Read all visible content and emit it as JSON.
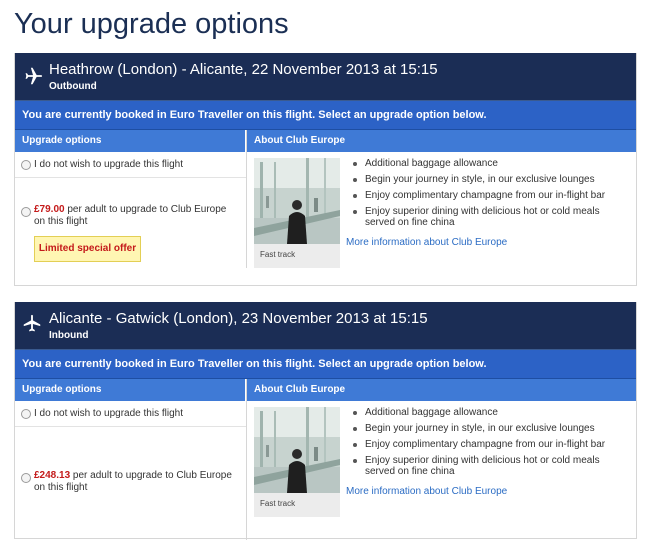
{
  "page": {
    "title": "Your upgrade options"
  },
  "flights": [
    {
      "title": "Heathrow (London) - Alicante, 22 November 2013 at 15:15",
      "direction": "Outbound",
      "notice": "You are currently booked in Euro Traveller on this flight. Select an upgrade option below.",
      "options_header": "Upgrade options",
      "about_header": "About Club Europe",
      "no_upgrade_label": "I do not wish to upgrade this flight",
      "upgrade_price": "£79.00",
      "upgrade_text": " per adult to upgrade to Club Europe on this flight",
      "offer_label": "Limited special offer",
      "photo_caption": "Fast track",
      "benefits": [
        "Additional baggage allowance",
        "Begin your journey in style, in our exclusive lounges",
        "Enjoy complimentary champagne from our in-flight bar",
        "Enjoy superior dining with delicious hot or cold meals served on fine china"
      ],
      "more_link": "More information about Club Europe"
    },
    {
      "title": "Alicante - Gatwick (London), 23 November 2013 at 15:15",
      "direction": "Inbound",
      "notice": "You are currently booked in Euro Traveller on this flight. Select an upgrade option below.",
      "options_header": "Upgrade options",
      "about_header": "About Club Europe",
      "no_upgrade_label": "I do not wish to upgrade this flight",
      "upgrade_price": "£248.13",
      "upgrade_text": " per adult to upgrade to Club Europe on this flight",
      "photo_caption": "Fast track",
      "benefits": [
        "Additional baggage allowance",
        "Begin your journey in style, in our exclusive lounges",
        "Enjoy complimentary champagne from our in-flight bar",
        "Enjoy superior dining with delicious hot or cold meals served on fine china"
      ],
      "more_link": "More information about Club Europe"
    }
  ],
  "colors": {
    "header_bg": "#1b2d55",
    "notice_bg": "#2c62c6",
    "column_header_bg": "#3f7ad6",
    "price": "#c41a1a",
    "offer_bg": "#fff6b3",
    "link": "#2b6cc4"
  },
  "icons": {
    "flight_icon": "airplane-icon"
  }
}
